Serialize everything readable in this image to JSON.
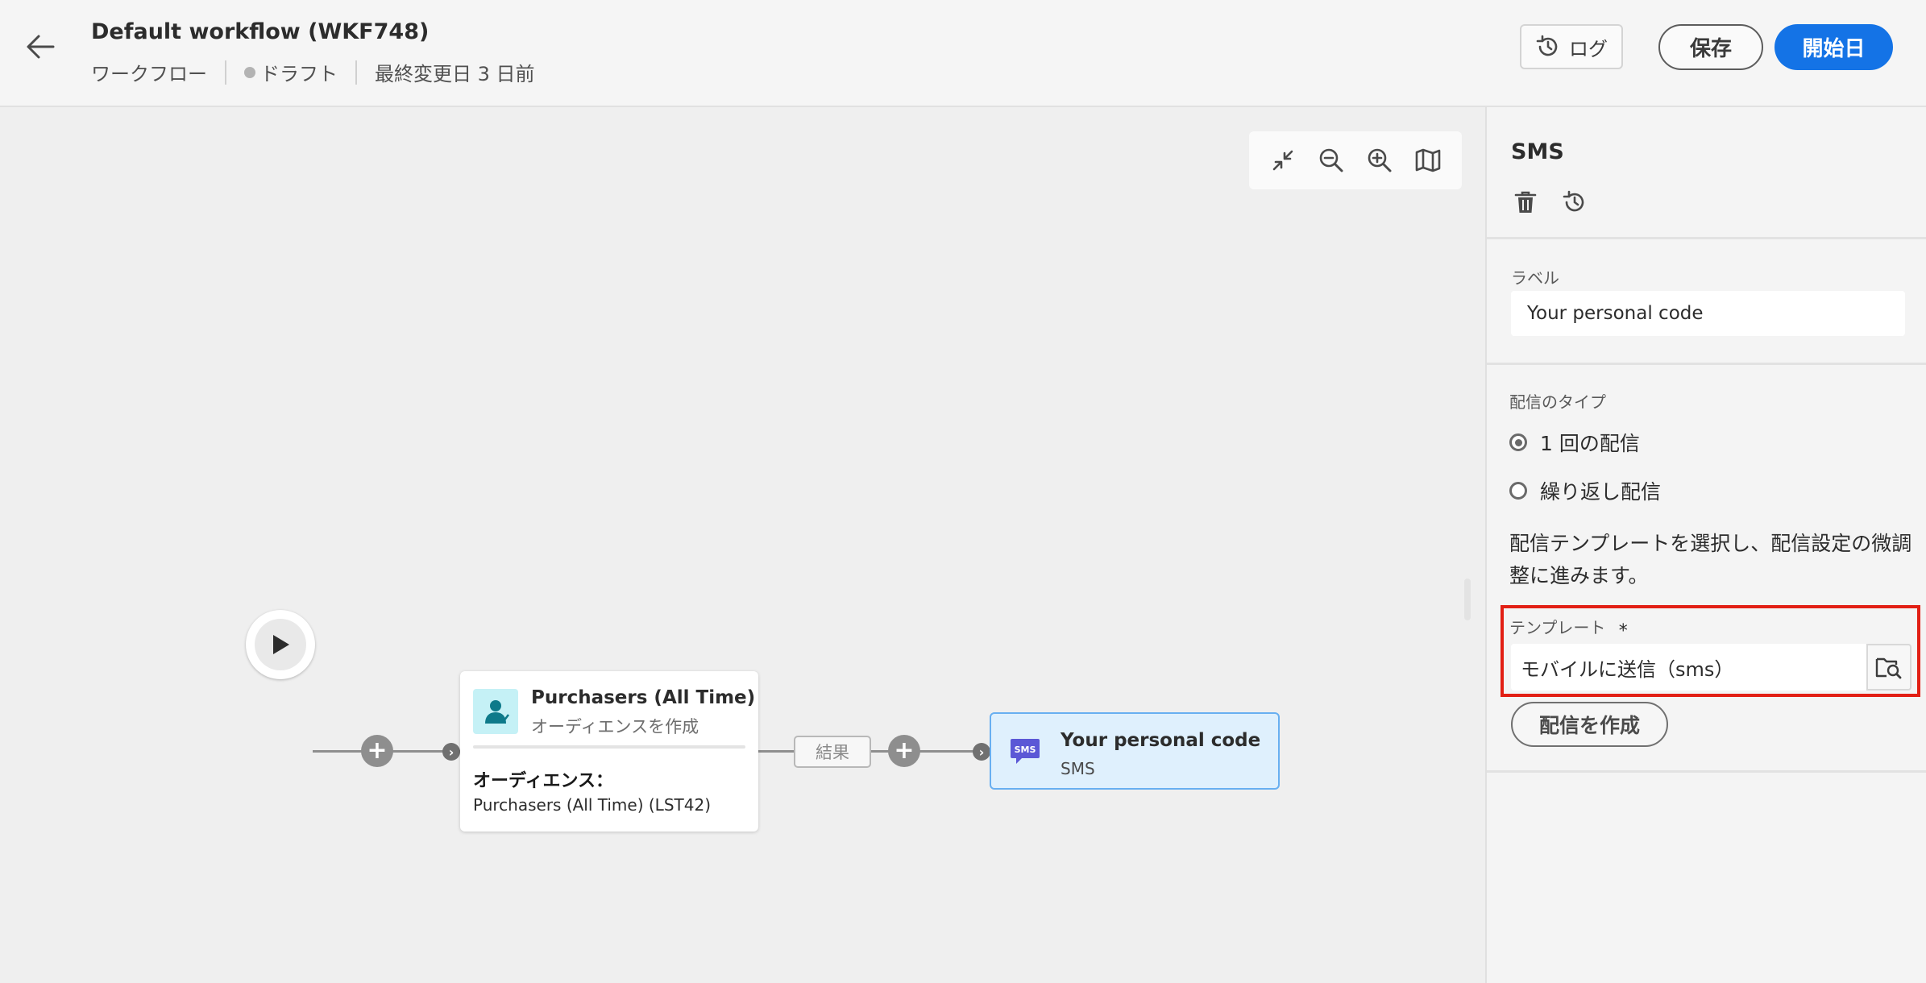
{
  "header": {
    "title": "Default workflow (WKF748)",
    "breadcrumb": "ワークフロー",
    "status": "ドラフト",
    "last_modified": "最終変更日 3 日前",
    "log_label": "ログ",
    "save_label": "保存",
    "start_label": "開始日"
  },
  "canvas": {
    "audience_node": {
      "title": "Purchasers (All Time)",
      "subtitle": "オーディエンスを作成",
      "audience_label": "オーディエンス：",
      "audience_value": "Purchasers (All Time) (LST42)"
    },
    "result_label": "結果",
    "sms_node": {
      "title": "Your personal code",
      "subtitle": "SMS",
      "icon_text": "SMS"
    }
  },
  "panel": {
    "title": "SMS",
    "label_field": {
      "label": "ラベル",
      "value": "Your personal code"
    },
    "delivery_type": {
      "label": "配信のタイプ",
      "options": [
        {
          "label": "1 回の配信",
          "selected": true
        },
        {
          "label": "繰り返し配信",
          "selected": false
        }
      ]
    },
    "help_text": "配信テンプレートを選択し、配信設定の微調整に進みます。",
    "template_field": {
      "label": "テンプレート",
      "required_mark": "*",
      "value": "モバイルに送信（sms）"
    },
    "create_delivery_label": "配信を作成"
  },
  "colors": {
    "accent": "#1473e6",
    "highlight_border": "#e21f14",
    "selected_node_bg": "#dff0fd",
    "selected_node_border": "#68aff1",
    "audience_icon_bg": "#c5f1f6",
    "sms_icon": "#5b57d6"
  },
  "icons": [
    "back-arrow-icon",
    "history-icon",
    "collapse-icon",
    "zoom-out-icon",
    "zoom-in-icon",
    "map-icon",
    "play-icon",
    "plus-icon",
    "chevron-right-icon",
    "audience-icon",
    "sms-icon",
    "trash-icon",
    "folder-search-icon"
  ]
}
